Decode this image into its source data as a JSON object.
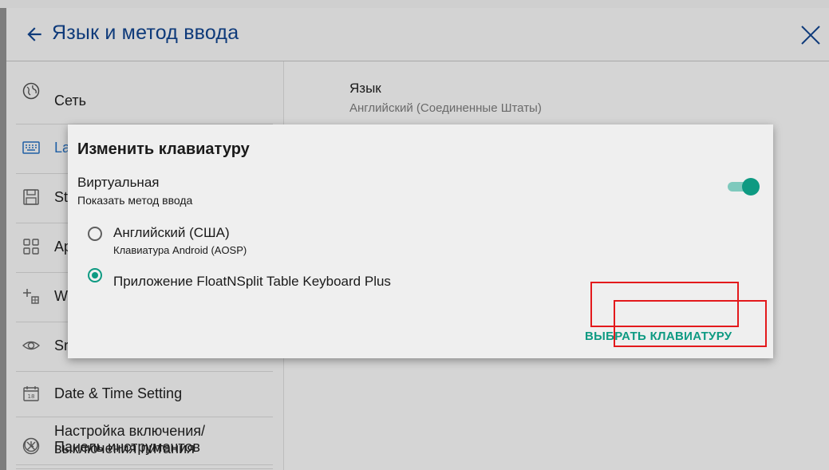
{
  "header": {
    "title": "Язык и метод ввода"
  },
  "sidebar": {
    "items": [
      {
        "label": "Сеть"
      },
      {
        "label": "La"
      },
      {
        "label": "St"
      },
      {
        "label": "Ap"
      },
      {
        "label": "W"
      },
      {
        "label": "Sr"
      },
      {
        "label": "Date & Time Setting"
      },
      {
        "label": "Настройка включения/ выключения питания"
      },
      {
        "label": "Панель инструментов"
      }
    ]
  },
  "content": {
    "language_title": "Язык",
    "language_value": "Английский (Соединенные Штаты)"
  },
  "dialog": {
    "title": "Изменить клавиатуру",
    "virtual_title": "Виртуальная",
    "virtual_subtitle": "Показать метод ввода",
    "virtual_enabled": true,
    "options": [
      {
        "label": "Английский (США)",
        "sublabel": "Клавиатура Android (AOSP)",
        "selected": false
      },
      {
        "label": "Приложение FloatNSplit Table Keyboard Plus",
        "selected": true
      }
    ],
    "choose_button": "ВЫБРАТЬ КЛАВИАТУРУ"
  },
  "colors": {
    "accent": "#0e9a82",
    "header_text": "#0e3a7a",
    "highlight": "#e3191c"
  }
}
